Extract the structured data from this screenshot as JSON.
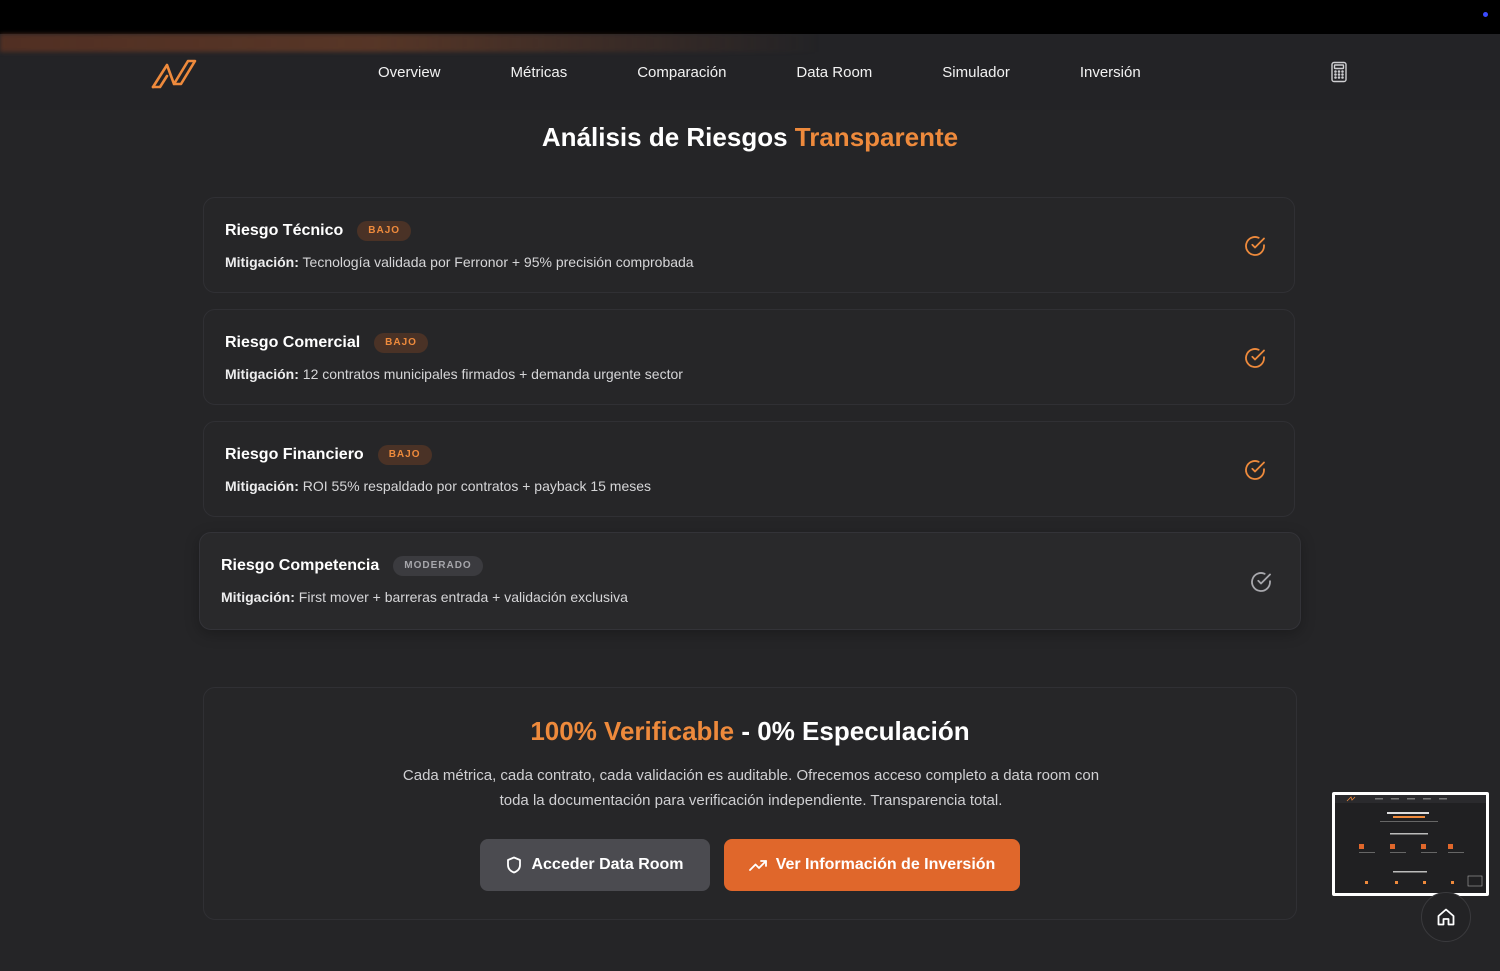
{
  "nav": {
    "links": [
      "Overview",
      "Métricas",
      "Comparación",
      "Data Room",
      "Simulador",
      "Inversión"
    ]
  },
  "section": {
    "title_main": "Análisis de Riesgos ",
    "title_accent": "Transparente"
  },
  "risks": [
    {
      "title": "Riesgo Técnico",
      "badge": "BAJO",
      "mitig_label": "Mitigación:",
      "mitig_text": " Tecnología validada por Ferronor + 95% precisión comprobada"
    },
    {
      "title": "Riesgo Comercial",
      "badge": "BAJO",
      "mitig_label": "Mitigación:",
      "mitig_text": " 12 contratos municipales firmados + demanda urgente sector"
    },
    {
      "title": "Riesgo Financiero",
      "badge": "BAJO",
      "mitig_label": "Mitigación:",
      "mitig_text": " ROI 55% respaldado por contratos + payback 15 meses"
    },
    {
      "title": "Riesgo Competencia",
      "badge": "MODERADO",
      "mitig_label": "Mitigación:",
      "mitig_text": " First mover + barreras entrada + validación exclusiva"
    }
  ],
  "cta": {
    "title_accent": "100% Verificable",
    "title_rest": " - 0% Especulación",
    "text": "Cada métrica, cada contrato, cada validación es auditable. Ofrecemos acceso completo a data room con toda la documentación para verificación independiente. Transparencia total.",
    "btn_dataroom": "Acceder Data Room",
    "btn_invest": "Ver Información de Inversión"
  },
  "colors": {
    "accent": "#ee8a3c",
    "button_orange": "#e0672b",
    "background": "#252527"
  },
  "icons": [
    "logo-icon",
    "calculator-icon",
    "check-circle-icon",
    "shield-icon",
    "trending-up-icon",
    "home-icon"
  ]
}
